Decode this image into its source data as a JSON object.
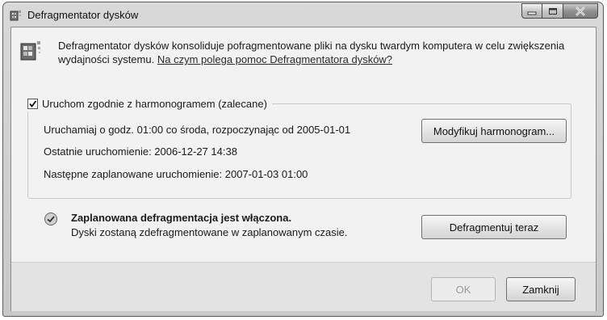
{
  "window": {
    "title": "Defragmentator dysków"
  },
  "intro": {
    "text": "Defragmentator dysków konsoliduje pofragmentowane pliki na dysku twardym komputera w celu zwiększenia wydajności systemu.",
    "link": "Na czym polega pomoc Defragmentatora dysków?"
  },
  "schedule": {
    "checkbox_label": "Uruchom zgodnie z harmonogramem (zalecane)",
    "checked": true,
    "run_line": "Uruchamiaj o godz. 01:00 co środa, rozpoczynając od 2005-01-01",
    "last_run": "Ostatnie uruchomienie: 2006-12-27 14:38",
    "next_run": "Następne zaplanowane uruchomienie: 2007-01-03 01:00",
    "modify_button": "Modyfikuj harmonogram..."
  },
  "status": {
    "title": "Zaplanowana defragmentacja jest włączona.",
    "subtitle": "Dyski zostaną zdefragmentowane w zaplanowanym czasie.",
    "defrag_button": "Defragmentuj teraz"
  },
  "footer": {
    "ok_button": "OK",
    "close_button": "Zamknij"
  }
}
